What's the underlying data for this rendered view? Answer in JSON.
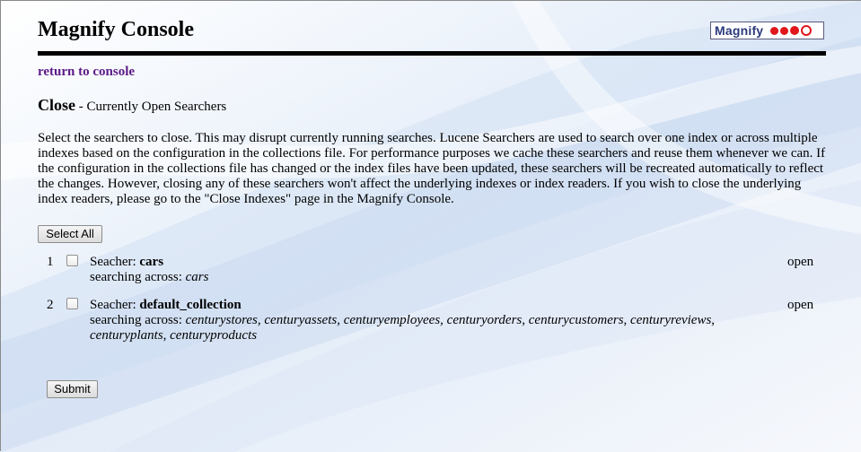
{
  "header": {
    "title": "Magnify Console",
    "logo_text": "Magnify"
  },
  "nav": {
    "return_link": "return to console"
  },
  "section": {
    "title": "Close",
    "subtitle": " - Currently Open Searchers"
  },
  "description": "Select the searchers to close. This may disrupt currently running searches. Lucene Searchers are used to search over one index or across multiple indexes based on the configuration in the collections file. For performance purposes we cache these searchers and reuse them whenever we can. If the configuration in the collections file has changed or the index files have been updated, these searchers will be recreated automatically to reflect the changes. However, closing any of these searchers won't affect the underlying indexes or index readers. If you wish to close the underlying index readers, please go to the \"Close Indexes\" page in the Magnify Console.",
  "buttons": {
    "select_all": "Select All",
    "submit": "Submit"
  },
  "searchers": [
    {
      "num": "1",
      "label": "Seacher: ",
      "name": "cars",
      "across_label": "searching across: ",
      "across": "cars",
      "status": "open"
    },
    {
      "num": "2",
      "label": "Seacher: ",
      "name": "default_collection",
      "across_label": "searching across: ",
      "across": "centurystores, centuryassets, centuryemployees, centuryorders, centurycustomers, centuryreviews, centuryplants, centuryproducts",
      "status": "open"
    }
  ],
  "colors": {
    "link": "#5c1a86",
    "logo_text": "#2b3a7a",
    "logo_dots": "#e0161b"
  }
}
